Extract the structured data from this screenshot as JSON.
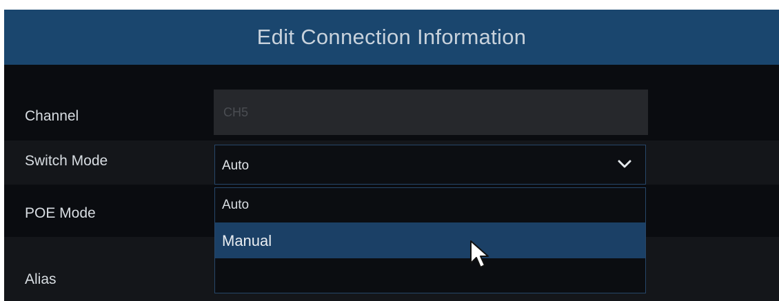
{
  "dialog": {
    "title": "Edit Connection Information"
  },
  "fields": {
    "channel": {
      "label": "Channel",
      "value": "CH5"
    },
    "switch_mode": {
      "label": "Switch Mode",
      "value": "Auto",
      "options": [
        "Auto",
        "Manual"
      ],
      "hovered_option": "Manual",
      "expanded": true
    },
    "poe_mode": {
      "label": "POE Mode"
    },
    "alias": {
      "label": "Alias"
    }
  },
  "icons": {
    "dropdown": "chevron-down-icon",
    "pointer": "mouse-cursor-icon"
  },
  "colors": {
    "title_bar": "#1a466e",
    "background": "#0a0c10",
    "hover_highlight": "#1b4066",
    "border": "#27476a"
  }
}
